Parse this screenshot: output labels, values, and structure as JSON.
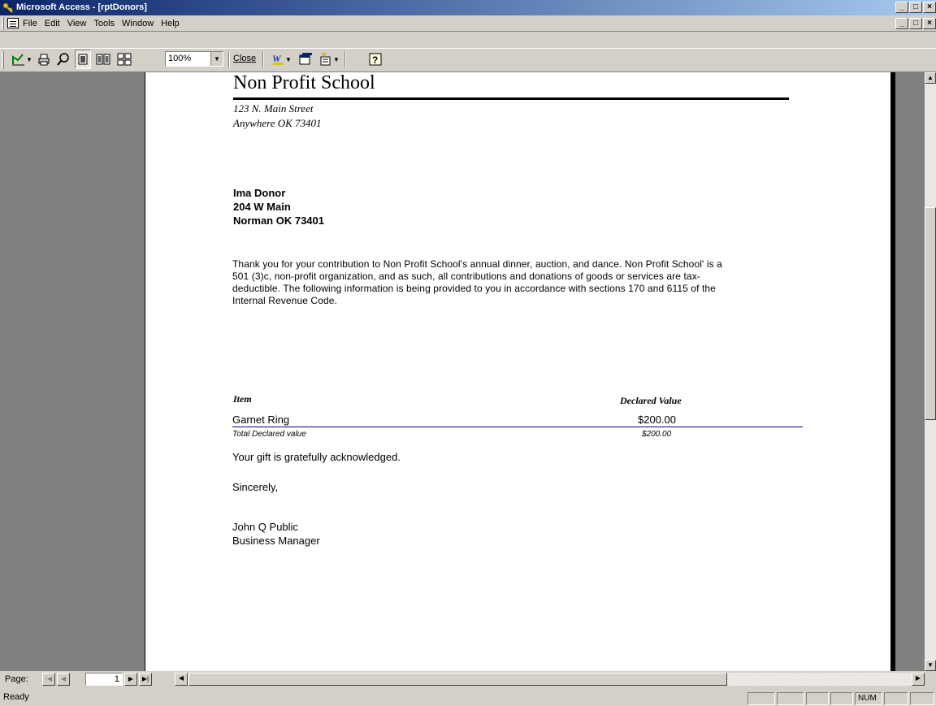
{
  "window": {
    "title": "Microsoft Access - [rptDonors]"
  },
  "menu": {
    "items": [
      "File",
      "Edit",
      "View",
      "Tools",
      "Window",
      "Help"
    ]
  },
  "toolbar": {
    "zoom_value": "100%",
    "close_label": "Close"
  },
  "report": {
    "org_name": "Non Profit School",
    "org_address_line1": "123  N.  Main Street",
    "org_address_line2": "Anywhere OK  73401",
    "donor_name": "Ima Donor",
    "donor_address_line1": "204 W Main",
    "donor_address_line2": "Norman OK 73401",
    "body_paragraph": "Thank you for your contribution to Non Profit School's annual dinner, auction, and dance. Non Profit School' is a 501 (3)c, non-profit organization, and as such, all contributions and donations of goods or services are tax-deductible.  The following information is being provided to you in accordance with sections 170 and 6115 of the Internal Revenue Code.",
    "table": {
      "col_item": "Item",
      "col_value": "Declared Value",
      "rows": [
        {
          "item": "Garnet Ring",
          "value": "$200.00"
        }
      ],
      "total_label": "Total Declared value",
      "total_value": "$200.00"
    },
    "acknowledgement": "Your gift is gratefully acknowledged.",
    "closing": "Sincerely,",
    "signer_name": "John Q Public",
    "signer_title": "Business Manager"
  },
  "navigation": {
    "page_label": "Page:",
    "page_value": "1"
  },
  "status": {
    "text": "Ready",
    "num_indicator": "NUM"
  }
}
